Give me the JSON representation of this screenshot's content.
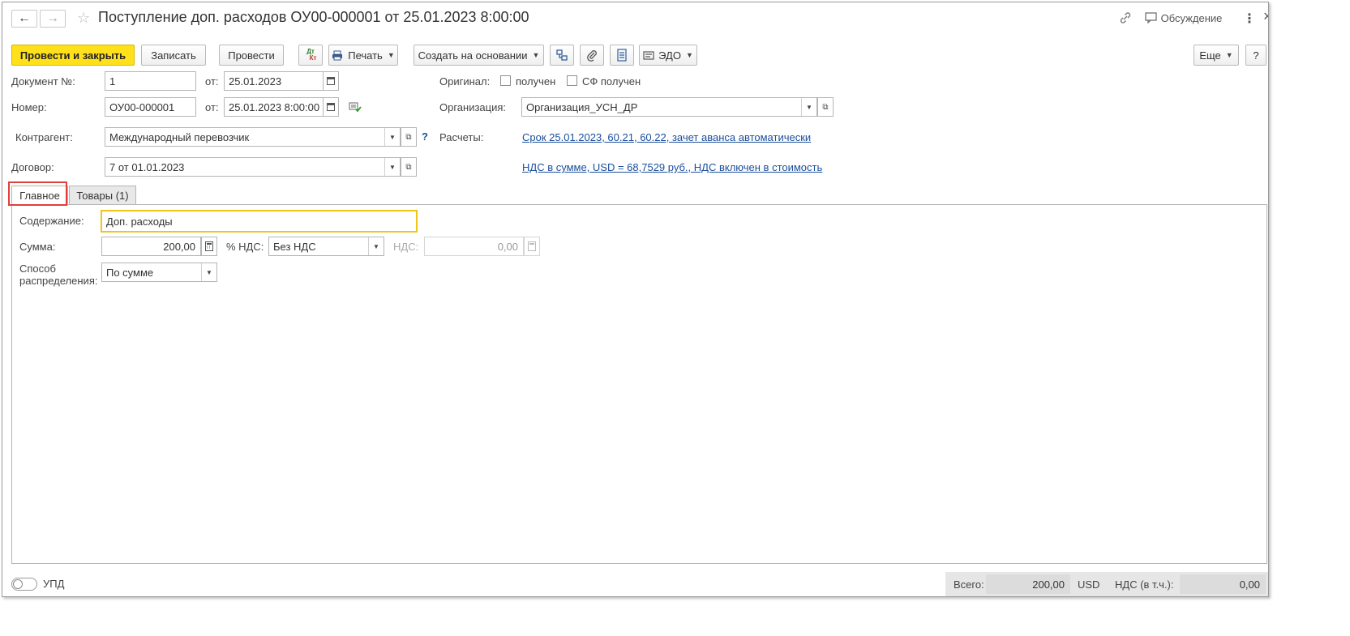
{
  "header": {
    "title": "Поступление доп. расходов ОУ00-000001 от 25.01.2023 8:00:00",
    "back_icon": "←",
    "forward_icon": "→",
    "star_icon": "☆",
    "link_icon": "🔗",
    "discussion_label": "Обсуждение",
    "more_icon": "⋮",
    "close_icon": "×"
  },
  "toolbar": {
    "post_close": "Провести и закрыть",
    "save": "Записать",
    "post": "Провести",
    "dtkt_top": "Дт",
    "dtkt_bottom": "Кт",
    "print": "Печать",
    "create_based": "Создать на основании",
    "edo": "ЭДО",
    "more": "Еще",
    "help": "?"
  },
  "form": {
    "doc_no_label": "Документ №:",
    "doc_no_value": "1",
    "from_label": "от:",
    "doc_date_value": "25.01.2023",
    "number_label": "Номер:",
    "number_value": "ОУ00-000001",
    "number_date_value": "25.01.2023  8:00:00",
    "original_label": "Оригинал:",
    "received_label": "получен",
    "sf_received_label": "СФ получен",
    "org_label": "Организация:",
    "org_value": "Организация_УСН_ДР",
    "counterparty_label": "Контрагент:",
    "counterparty_value": "Международный перевозчик",
    "help_q": "?",
    "settlements_label": "Расчеты:",
    "settlements_link": "Срок 25.01.2023, 60.21, 60.22, зачет аванса автоматически",
    "contract_label": "Договор:",
    "contract_value": "7 от 01.01.2023",
    "vat_link": "НДС в сумме, USD = 68,7529 руб., НДС включен в стоимость"
  },
  "tabs": [
    {
      "label": "Главное"
    },
    {
      "label": "Товары (1)"
    }
  ],
  "main_tab": {
    "content_label": "Содержание:",
    "content_value": "Доп. расходы",
    "sum_label": "Сумма:",
    "sum_value": "200,00",
    "vat_pct_label": "% НДС:",
    "vat_pct_value": "Без НДС",
    "vat_label": "НДС:",
    "vat_value": "0,00",
    "distribution_label_1": "Способ",
    "distribution_label_2": "распределения:",
    "distribution_value": "По сумме"
  },
  "footer": {
    "upd_label": "УПД",
    "total_label": "Всего:",
    "total_value": "200,00",
    "currency": "USD",
    "vat_incl_label": "НДС (в т.ч.):",
    "vat_incl_value": "0,00"
  },
  "colors": {
    "primary_button": "#ffe01a",
    "link": "#1a4f9c",
    "active_field_border": "#f0c419",
    "tab_highlight": "#e0403a"
  }
}
